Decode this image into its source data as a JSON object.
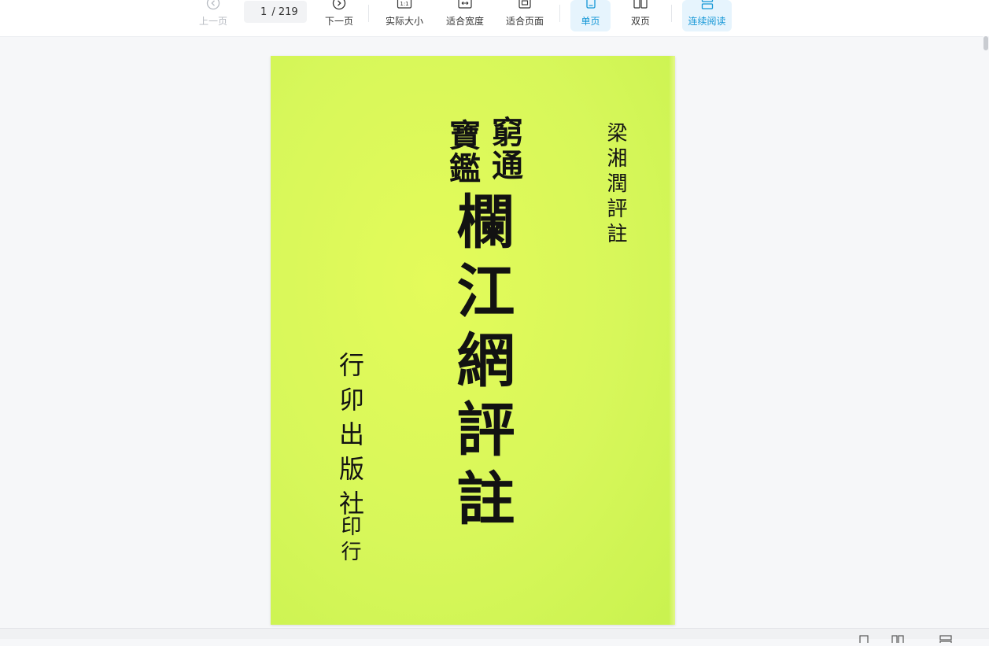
{
  "toolbar": {
    "prev_label": "上一页",
    "page_current": "1",
    "page_total": "/ 219",
    "next_label": "下一页",
    "actual_size_label": "实际大小",
    "fit_width_label": "适合宽度",
    "fit_page_label": "适合页面",
    "single_page_label": "单页",
    "double_page_label": "双页",
    "continuous_label": "连续阅读",
    "actual_size_icon_text": "1:1",
    "active_color": "#1396d6",
    "disabled_color": "#b7bbc2"
  },
  "document": {
    "sub_title_right": "窮通",
    "sub_title_left": "寶鑑",
    "main_title": "欄江網評註",
    "author": "梁湘潤評註",
    "publisher_line1": "行卯出版社",
    "publisher_line2": "印行",
    "cover_color": "#d7f75a"
  },
  "icons": {
    "prev": "chevron-left-circle-icon",
    "next": "chevron-right-circle-icon",
    "actual_size": "actual-size-icon",
    "fit_width": "fit-width-icon",
    "fit_page": "fit-page-icon",
    "single_page": "single-page-icon",
    "double_page": "double-page-icon",
    "continuous": "continuous-read-icon"
  }
}
